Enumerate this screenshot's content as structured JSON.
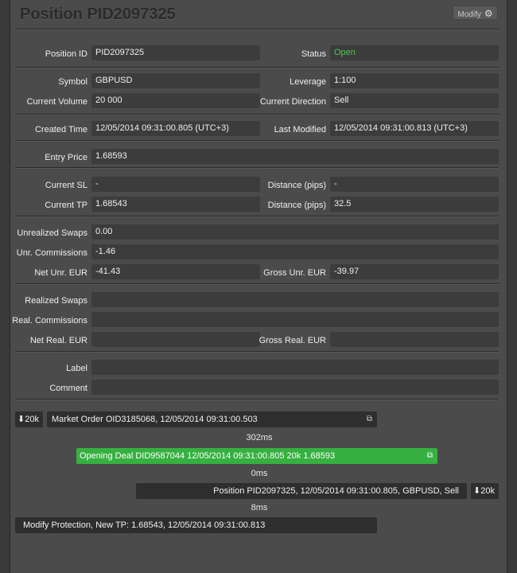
{
  "header": {
    "title": "Position PID2097325",
    "modify_label": "Modify",
    "modify_icon": "gear-icon"
  },
  "fields": {
    "position_id": {
      "label": "Position ID",
      "value": "PID2097325"
    },
    "status": {
      "label": "Status",
      "value": "Open",
      "color": "#4cc94c"
    },
    "symbol": {
      "label": "Symbol",
      "value": "GBPUSD"
    },
    "leverage": {
      "label": "Leverage",
      "value": "1:100"
    },
    "current_volume": {
      "label": "Current Volume",
      "value": "20 000"
    },
    "current_direction": {
      "label": "Current Direction",
      "value": "Sell"
    },
    "created_time": {
      "label": "Created Time",
      "value": "12/05/2014 09:31:00.805 (UTC+3)"
    },
    "last_modified": {
      "label": "Last Modified",
      "value": "12/05/2014 09:31:00.813 (UTC+3)"
    },
    "entry_price": {
      "label": "Entry Price",
      "value": "1.68593"
    },
    "current_sl": {
      "label": "Current SL",
      "value": "-"
    },
    "distance_sl": {
      "label": "Distance (pips)",
      "value": "-"
    },
    "current_tp": {
      "label": "Current TP",
      "value": "1.68543"
    },
    "distance_tp": {
      "label": "Distance (pips)",
      "value": "32.5"
    },
    "unrealized_swaps": {
      "label": "Unrealized Swaps",
      "value": "0.00"
    },
    "unr_commissions": {
      "label": "Unr. Commissions",
      "value": "-1.46"
    },
    "net_unr": {
      "label": "Net Unr. EUR",
      "value": "-41.43"
    },
    "gross_unr": {
      "label": "Gross Unr. EUR",
      "value": "-39.97"
    },
    "realized_swaps": {
      "label": "Realized Swaps",
      "value": ""
    },
    "real_commissions": {
      "label": "Real. Commissions",
      "value": ""
    },
    "net_real": {
      "label": "Net Real. EUR",
      "value": ""
    },
    "gross_real": {
      "label": "Gross Real. EUR",
      "value": ""
    },
    "label": {
      "label": "Label",
      "value": ""
    },
    "comment": {
      "label": "Comment",
      "value": ""
    }
  },
  "timeline": {
    "order_volume": "20k",
    "market_order": "Market Order OID3185068, 12/05/2014 09:31:00.503",
    "gap1": "302ms",
    "opening_deal": "Opening Deal DID9587044 12/05/2014 09:31:00.805 20k 1.68593",
    "gap2": "0ms",
    "position": "Position PID2097325, 12/05/2014 09:31:00.805, GBPUSD, Sell",
    "position_volume": "20k",
    "gap3": "8ms",
    "modify_protection": "Modify Protection, New TP: 1.68543, 12/05/2014 09:31:00.813"
  }
}
